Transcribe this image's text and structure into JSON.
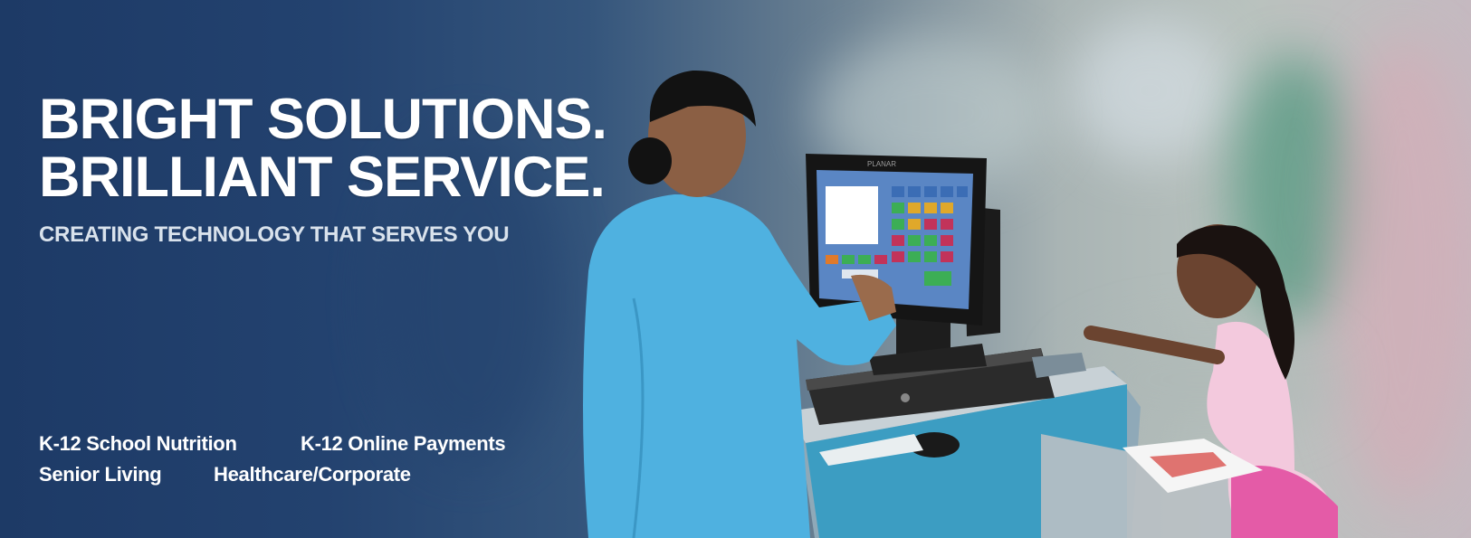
{
  "hero": {
    "headline_line1": "BRIGHT SOLUTIONS.",
    "headline_line2": "BRILLIANT SERVICE.",
    "subheadline": "CREATING TECHNOLOGY THAT SERVES YOU",
    "monitor_brand": "PLANAR"
  },
  "segments": [
    {
      "label": "K-12 School Nutrition"
    },
    {
      "label": "K-12 Online Payments"
    },
    {
      "label": "Senior Living"
    },
    {
      "label": "Healthcare/Corporate"
    }
  ],
  "colors": {
    "background_left": "#1d3a66",
    "background_right": "#b9c2be",
    "headline": "#ffffff",
    "scrubs": "#4fb1e0"
  }
}
